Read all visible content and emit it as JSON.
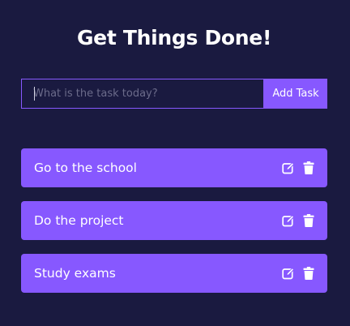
{
  "header": {
    "title": "Get Things Done!"
  },
  "form": {
    "placeholder": "What is the task today?",
    "value": "",
    "add_label": "Add Task"
  },
  "todos": [
    {
      "text": "Go to the school",
      "actions": [
        "edit-icon",
        "trash-icon"
      ]
    },
    {
      "text": "Do the project",
      "actions": [
        "edit-icon",
        "trash-icon"
      ]
    },
    {
      "text": "Study exams",
      "actions": [
        "edit-icon",
        "trash-icon"
      ]
    }
  ],
  "colors": {
    "background": "#1a1a40",
    "accent": "#8758ff",
    "text": "#ffffff",
    "placeholder": "#6b6b8a"
  }
}
